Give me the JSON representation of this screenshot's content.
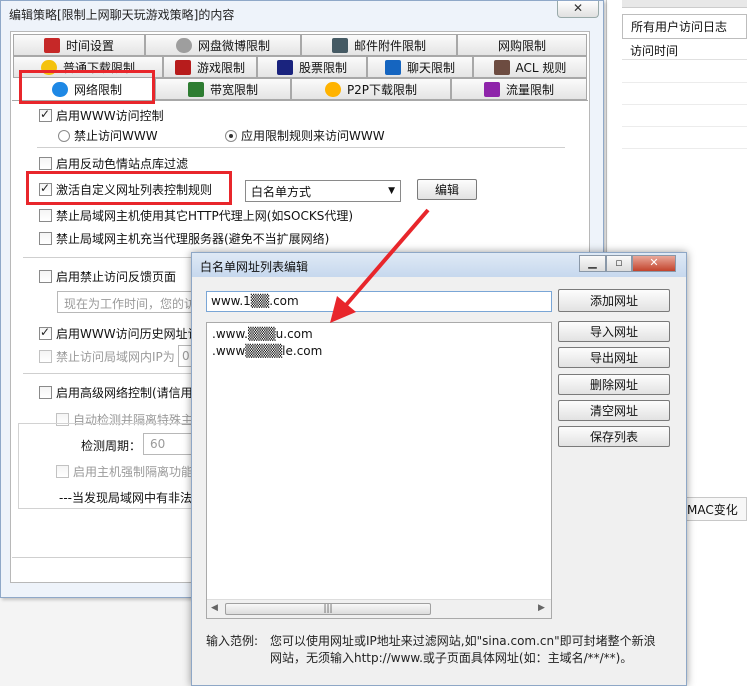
{
  "background": {
    "tab_label": "所有用户访问日志",
    "subheader": "访问时间",
    "mac_label": "MAC变化"
  },
  "main_window": {
    "title": "编辑策略[限制上网聊天玩游戏策略]的内容",
    "close_label": "✕",
    "tabs_row1": [
      "时间设置",
      "网盘微博限制",
      "邮件附件限制",
      "网购限制"
    ],
    "tabs_row2": [
      "普通下载限制",
      "游戏限制",
      "股票限制",
      "聊天限制",
      "ACL 规则"
    ],
    "tabs_row3": [
      "网络限制",
      "带宽限制",
      "P2P下载限制",
      "流量限制"
    ],
    "active_tab": "网络限制",
    "www_control": {
      "label": "启用WWW访问控制",
      "checked": true,
      "radio_forbid": "禁止访问WWW",
      "radio_rule": "应用限制规则来访问WWW",
      "selected": "radio_rule"
    },
    "anti_porn": {
      "label": "启用反动色情站点库过滤",
      "checked": false
    },
    "custom_list": {
      "label": "激活自定义网址列表控制规则",
      "checked": true,
      "mode": "白名单方式",
      "edit_button": "编辑"
    },
    "proxy_http": {
      "label": "禁止局域网主机使用其它HTTP代理上网(如SOCKS代理)",
      "checked": false
    },
    "proxy_server": {
      "label": "禁止局域网主机充当代理服务器(避免不当扩展网络)",
      "checked": false
    },
    "feedback": {
      "label": "启用禁止访问反馈页面",
      "checked": false,
      "placeholder": "现在为工作时间，您的访"
    },
    "history": {
      "label": "启用WWW访问历史网址记",
      "checked": true
    },
    "lan_ip": {
      "label": "禁止访问局域网内IP为",
      "checked": false,
      "value": "0"
    },
    "advanced": {
      "label": "启用高级网络控制(请信用",
      "checked": false
    },
    "auto_detect": {
      "label": "自动检测并隔离特殊主",
      "checked": false
    },
    "detect_period": {
      "label": "检测周期：",
      "value": "60"
    },
    "force_isolate": {
      "label": "启用主机强制隔离功能",
      "checked": false
    },
    "discovery_note": "---当发现局域网中有非法"
  },
  "popup": {
    "title": "白名单网址列表编辑",
    "url_input_value": "www.1▒▒.com",
    "urls": [
      ".www.▒▒▒u.com",
      ".www▒▒▒▒le.com"
    ],
    "buttons": [
      "添加网址",
      "导入网址",
      "导出网址",
      "删除网址",
      "清空网址",
      "保存列表"
    ],
    "help_label": "输入范例:",
    "help_text": "您可以使用网址或IP地址来过滤网站,如\"sina.com.cn\"即可封堵整个新浪网站，无须输入http://www.或子页面具体网址(如：主域名/**/**)。"
  },
  "colors": {
    "highlight": "#e8262b",
    "arrow": "#e8262b"
  }
}
